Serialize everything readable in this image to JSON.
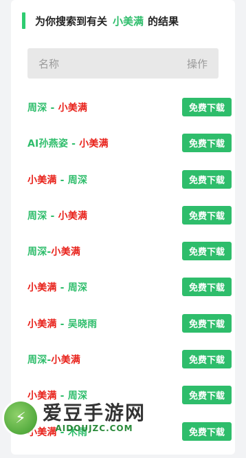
{
  "heading": {
    "prefix": "为你搜索到有关",
    "keyword": "小美满",
    "suffix": "的结果"
  },
  "table_header": {
    "name_col": "名称",
    "action_col": "操作"
  },
  "rows": [
    {
      "parts": [
        {
          "t": "周深",
          "c": "g"
        },
        {
          "t": " - ",
          "c": "g"
        },
        {
          "t": "小美满",
          "c": "r"
        }
      ],
      "button": "免费下载"
    },
    {
      "parts": [
        {
          "t": "AI孙燕姿",
          "c": "g"
        },
        {
          "t": " - ",
          "c": "g"
        },
        {
          "t": "小美满",
          "c": "r"
        }
      ],
      "button": "免费下载"
    },
    {
      "parts": [
        {
          "t": "小美满",
          "c": "r"
        },
        {
          "t": " - ",
          "c": "g"
        },
        {
          "t": "周深",
          "c": "g"
        }
      ],
      "button": "免费下载"
    },
    {
      "parts": [
        {
          "t": "周深",
          "c": "g"
        },
        {
          "t": " - ",
          "c": "g"
        },
        {
          "t": "小美满",
          "c": "r"
        }
      ],
      "button": "免费下载"
    },
    {
      "parts": [
        {
          "t": "周深",
          "c": "g"
        },
        {
          "t": "-",
          "c": "g"
        },
        {
          "t": "小美满",
          "c": "r"
        }
      ],
      "button": "免费下载"
    },
    {
      "parts": [
        {
          "t": "小美满",
          "c": "r"
        },
        {
          "t": " - ",
          "c": "g"
        },
        {
          "t": "周深",
          "c": "g"
        }
      ],
      "button": "免费下载"
    },
    {
      "parts": [
        {
          "t": "小美满",
          "c": "r"
        },
        {
          "t": " - ",
          "c": "g"
        },
        {
          "t": "吴晓雨",
          "c": "g"
        }
      ],
      "button": "免费下载"
    },
    {
      "parts": [
        {
          "t": "周深",
          "c": "g"
        },
        {
          "t": "-",
          "c": "g"
        },
        {
          "t": "小美满",
          "c": "r"
        }
      ],
      "button": "免费下载"
    },
    {
      "parts": [
        {
          "t": "小美满",
          "c": "r"
        },
        {
          "t": " - ",
          "c": "g"
        },
        {
          "t": "周深",
          "c": "g"
        }
      ],
      "button": "免费下载"
    },
    {
      "parts": [
        {
          "t": "小美满",
          "c": "r"
        },
        {
          "t": " - ",
          "c": "g"
        },
        {
          "t": "木雨",
          "c": "g"
        }
      ],
      "button": "免费下载"
    }
  ],
  "watermark": {
    "name": "爱豆手游网",
    "url": "AIDOUJZC.COM"
  },
  "colors": {
    "accent_green": "#2ebd6b",
    "keyword_red": "#e8211a"
  },
  "icons": {
    "watermark_logo": "lightning-bolt-icon"
  }
}
